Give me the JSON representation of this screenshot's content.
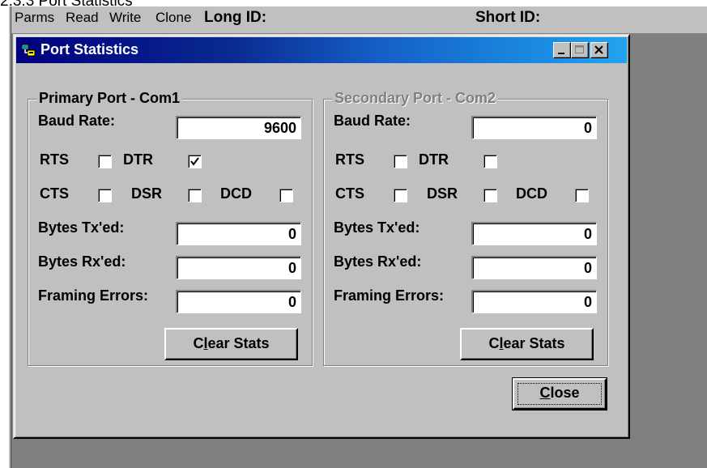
{
  "page_heading": "2.3.3 Port Statistics",
  "menubar": {
    "items": [
      "Parms",
      "Read",
      "Write",
      "Clone"
    ],
    "long_id_label": "Long ID:",
    "short_id_label": "Short ID:"
  },
  "dialog": {
    "title": "Port Statistics",
    "title_icon": "port-stats-app-icon",
    "close_button": {
      "label": "Close",
      "mnemonic": "C",
      "rest": "lose"
    }
  },
  "primary": {
    "group_title": "Primary Port - Com1",
    "baud_label": "Baud Rate:",
    "baud_value": "9600",
    "rts_label": "RTS",
    "dtr_label": "DTR",
    "cts_label": "CTS",
    "dsr_label": "DSR",
    "dcd_label": "DCD",
    "rts_checked": false,
    "dtr_checked": true,
    "cts_checked": false,
    "dsr_checked": false,
    "dcd_checked": false,
    "tx_label": "Bytes Tx'ed:",
    "tx_value": "0",
    "rx_label": "Bytes Rx'ed:",
    "rx_value": "0",
    "framing_label": "Framing Errors:",
    "framing_value": "0",
    "clear_button": {
      "pre": "C",
      "mnemonic": "l",
      "post": "ear Stats"
    }
  },
  "secondary": {
    "group_title": "Secondary Port - Com2",
    "enabled": false,
    "baud_label": "Baud Rate:",
    "baud_value": "0",
    "rts_label": "RTS",
    "dtr_label": "DTR",
    "cts_label": "CTS",
    "dsr_label": "DSR",
    "dcd_label": "DCD",
    "rts_checked": false,
    "dtr_checked": false,
    "cts_checked": false,
    "dsr_checked": false,
    "dcd_checked": false,
    "tx_label": "Bytes Tx'ed:",
    "tx_value": "0",
    "rx_label": "Bytes Rx'ed:",
    "rx_value": "0",
    "framing_label": "Framing Errors:",
    "framing_value": "0",
    "clear_button": {
      "pre": "C",
      "mnemonic": "l",
      "post": "ear Stats"
    }
  },
  "colors": {
    "face": "#c0c0c0",
    "title_start": "#000080",
    "title_end": "#23a3ee",
    "workspace": "#808080"
  }
}
